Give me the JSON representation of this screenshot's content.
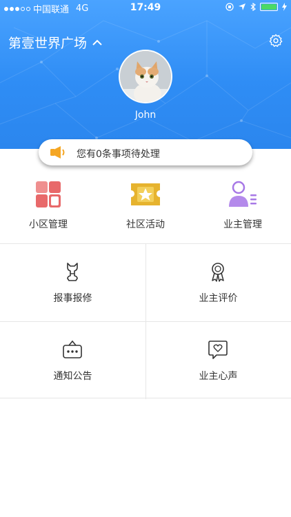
{
  "status_bar": {
    "carrier": "中国联通",
    "network": "4G",
    "time": "17:49"
  },
  "header": {
    "community_name": "第壹世界广场",
    "username": "John"
  },
  "notice": {
    "text": "您有0条事项待处理"
  },
  "quick_actions": [
    {
      "label": "小区管理",
      "icon": "grid-blocks-icon"
    },
    {
      "label": "社区活动",
      "icon": "star-ticket-icon"
    },
    {
      "label": "业主管理",
      "icon": "user-list-icon"
    }
  ],
  "services": [
    {
      "label": "报事报修",
      "icon": "wrench-icon"
    },
    {
      "label": "业主评价",
      "icon": "award-badge-icon"
    },
    {
      "label": "通知公告",
      "icon": "notice-board-icon"
    },
    {
      "label": "业主心声",
      "icon": "heart-message-icon"
    }
  ],
  "colors": {
    "header_blue": "#2f8df5",
    "speaker_orange": "#f5a623",
    "grid_red": "#e8696a",
    "ticket_gold": "#e6b32e",
    "user_purple": "#a778e6"
  }
}
